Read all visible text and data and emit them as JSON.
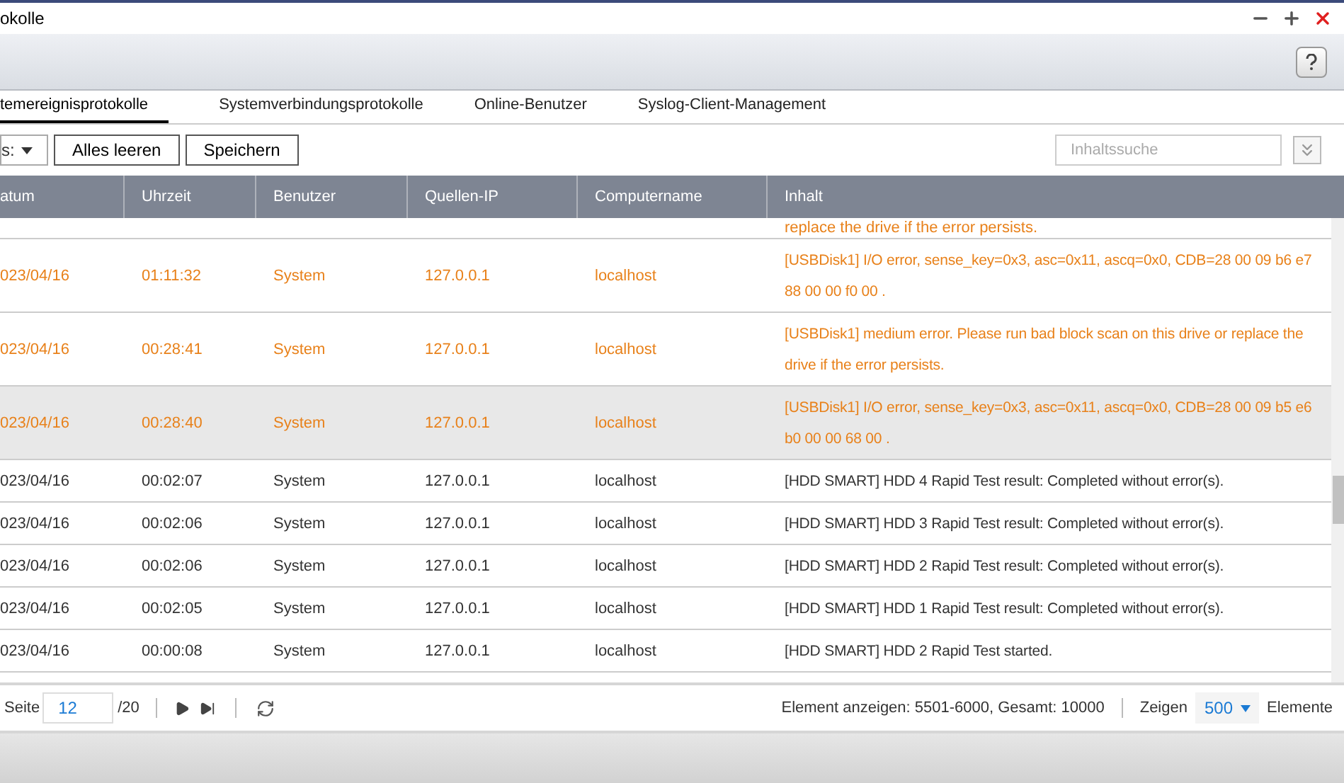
{
  "window": {
    "title": "okolle"
  },
  "tabs": [
    {
      "label": "temereignisprotokolle",
      "selected": true
    },
    {
      "label": "Systemverbindungsprotokolle",
      "selected": false
    },
    {
      "label": "Online-Benutzer",
      "selected": false
    },
    {
      "label": "Syslog-Client-Management",
      "selected": false
    }
  ],
  "filter": {
    "value": "s:"
  },
  "buttons": [
    "Alles leeren",
    "Speichern"
  ],
  "search": {
    "placeholder": "Inhaltssuche"
  },
  "table": {
    "columns": [
      "atum",
      "Uhrzeit",
      "Benutzer",
      "Quellen-IP",
      "Computername",
      "Inhalt"
    ],
    "partial_row": {
      "error": true,
      "text": "replace the drive if the error persists."
    },
    "rows": [
      {
        "error": true,
        "selected": false,
        "cells": [
          "023/04/16",
          "01:11:32",
          "System",
          "127.0.0.1",
          "localhost",
          "[USBDisk1] I/O error, sense_key=0x3, asc=0x11, ascq=0x0, CDB=28 00 09 b6 e7 88 00 00 f0 00 ."
        ]
      },
      {
        "error": true,
        "selected": false,
        "cells": [
          "023/04/16",
          "00:28:41",
          "System",
          "127.0.0.1",
          "localhost",
          "[USBDisk1] medium error. Please run bad block scan on this drive or replace the drive if the error persists."
        ]
      },
      {
        "error": true,
        "selected": true,
        "cells": [
          "023/04/16",
          "00:28:40",
          "System",
          "127.0.0.1",
          "localhost",
          "[USBDisk1] I/O error, sense_key=0x3, asc=0x11, ascq=0x0, CDB=28 00 09 b5 e6 b0 00 00 68 00 ."
        ]
      },
      {
        "error": false,
        "selected": false,
        "cells": [
          "023/04/16",
          "00:02:07",
          "System",
          "127.0.0.1",
          "localhost",
          "[HDD SMART] HDD 4 Rapid Test result: Completed without error(s)."
        ]
      },
      {
        "error": false,
        "selected": false,
        "cells": [
          "023/04/16",
          "00:02:06",
          "System",
          "127.0.0.1",
          "localhost",
          "[HDD SMART] HDD 3 Rapid Test result: Completed without error(s)."
        ]
      },
      {
        "error": false,
        "selected": false,
        "cells": [
          "023/04/16",
          "00:02:06",
          "System",
          "127.0.0.1",
          "localhost",
          "[HDD SMART] HDD 2 Rapid Test result: Completed without error(s)."
        ]
      },
      {
        "error": false,
        "selected": false,
        "cells": [
          "023/04/16",
          "00:02:05",
          "System",
          "127.0.0.1",
          "localhost",
          "[HDD SMART] HDD 1 Rapid Test result: Completed without error(s)."
        ]
      },
      {
        "error": false,
        "selected": false,
        "cells": [
          "023/04/16",
          "00:00:08",
          "System",
          "127.0.0.1",
          "localhost",
          "[HDD SMART] HDD 2 Rapid Test started."
        ]
      }
    ]
  },
  "pager": {
    "label": "Seite",
    "page": "12",
    "total": "/20",
    "summary": "Element anzeigen: 5501-6000, Gesamt: 10000",
    "show_label": "Zeigen",
    "per_page": "500",
    "unit": "Elemente"
  }
}
